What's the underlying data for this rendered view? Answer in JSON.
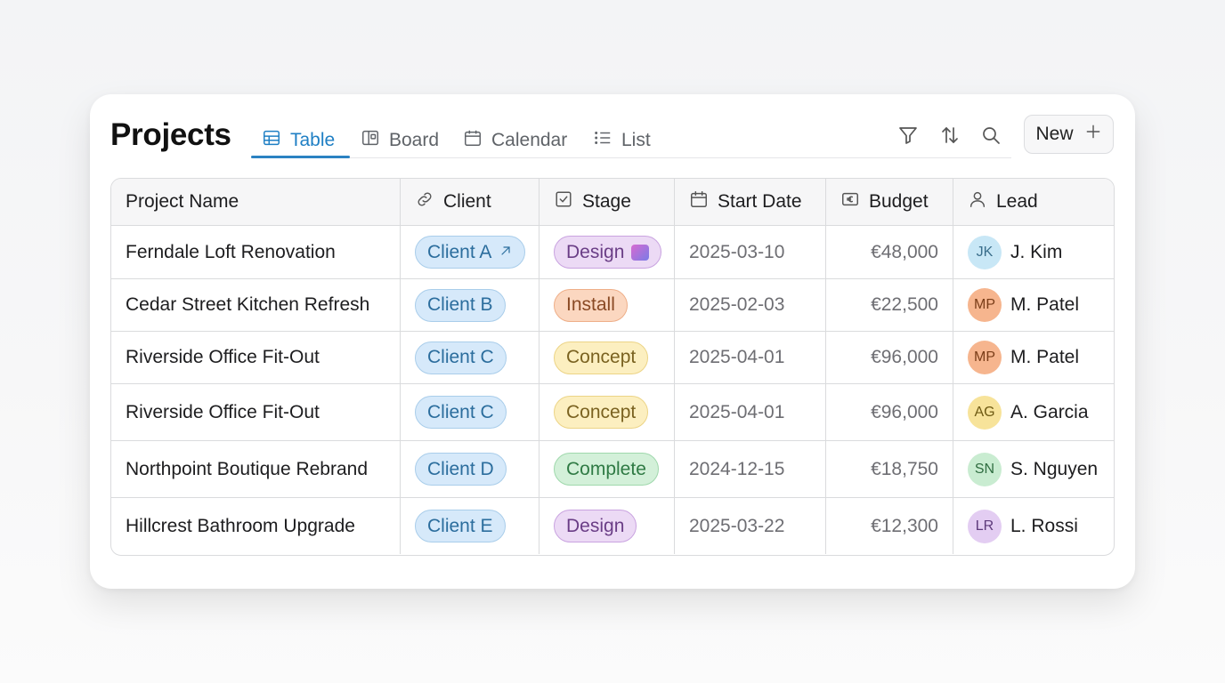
{
  "page": {
    "title": "Projects"
  },
  "tabs": [
    {
      "label": "Table",
      "icon": "table-icon",
      "active": true
    },
    {
      "label": "Board",
      "icon": "board-icon",
      "active": false
    },
    {
      "label": "Calendar",
      "icon": "calendar-icon",
      "active": false
    },
    {
      "label": "List",
      "icon": "list-icon",
      "active": false
    }
  ],
  "toolbar": {
    "icons": [
      "filter-icon",
      "sort-icon",
      "search-icon"
    ],
    "new_label": "New",
    "new_icon": "plus-icon"
  },
  "table": {
    "columns": [
      {
        "label": "Project Name",
        "icon": ""
      },
      {
        "label": "Client",
        "icon": "link-icon"
      },
      {
        "label": "Stage",
        "icon": "checkbox-icon"
      },
      {
        "label": "Start Date",
        "icon": "calendar-icon"
      },
      {
        "label": "Budget",
        "icon": "euro-icon"
      },
      {
        "label": "Lead",
        "icon": "person-icon"
      }
    ],
    "rows": [
      {
        "name": "Ferndale Loft Renovation",
        "client": "Client A",
        "client_link_icon": "arrow-up-right-icon",
        "stage": "Design",
        "stage_swatch": true,
        "start": "2025-03-10",
        "budget": "€48,000",
        "initials": "JK",
        "lead": "J. Kim"
      },
      {
        "name": "Cedar Street Kitchen Refresh",
        "client": "Client B",
        "stage": "Install",
        "start": "2025-02-03",
        "budget": "€22,500",
        "initials": "MP",
        "lead": "M. Patel"
      },
      {
        "name": "Riverside Office Fit-Out",
        "client": "Client C",
        "stage": "Concept",
        "start": "2025-04-01",
        "budget": "€96,000",
        "initials": "MP",
        "lead": "M. Patel"
      },
      {
        "name": "Riverside Office Fit-Out",
        "client": "Client C",
        "stage": "Concept",
        "start": "2025-04-01",
        "budget": "€96,000",
        "initials": "AG",
        "lead": "A. Garcia"
      },
      {
        "name": "Northpoint Boutique Rebrand",
        "client": "Client D",
        "stage": "Complete",
        "start": "2024-12-15",
        "budget": "€18,750",
        "initials": "SN",
        "lead": "S. Nguyen"
      },
      {
        "name": "Hillcrest Bathroom Upgrade",
        "client": "Client E",
        "stage": "Design",
        "start": "2025-03-22",
        "budget": "€12,300",
        "initials": "LR",
        "lead": "L. Rossi"
      }
    ]
  },
  "colors": {
    "accent": "#2b82c2",
    "client_pill": "#d6e9fa",
    "stage": {
      "Design": {
        "bg": "#ecdaf5",
        "border": "#c9a3e0",
        "fg": "#6a3d86"
      },
      "Install": {
        "bg": "#fbd7c0",
        "border": "#eeae88",
        "fg": "#8a4a24"
      },
      "Concept": {
        "bg": "#fcefc0",
        "border": "#ecd486",
        "fg": "#7a6220"
      },
      "Complete": {
        "bg": "#d3f0d9",
        "border": "#9fd8ac",
        "fg": "#2f7a44"
      }
    },
    "avatars": {
      "JK": {
        "bg": "#c8e7f6",
        "fg": "#3b6f8c"
      },
      "MP": {
        "bg": "#f6b58e",
        "fg": "#7a3d18"
      },
      "AG": {
        "bg": "#f7e39a",
        "fg": "#6e5a12"
      },
      "SN": {
        "bg": "#c9ecd1",
        "fg": "#2f6d40"
      },
      "LR": {
        "bg": "#e3cdf2",
        "fg": "#5d3a7a"
      }
    }
  }
}
